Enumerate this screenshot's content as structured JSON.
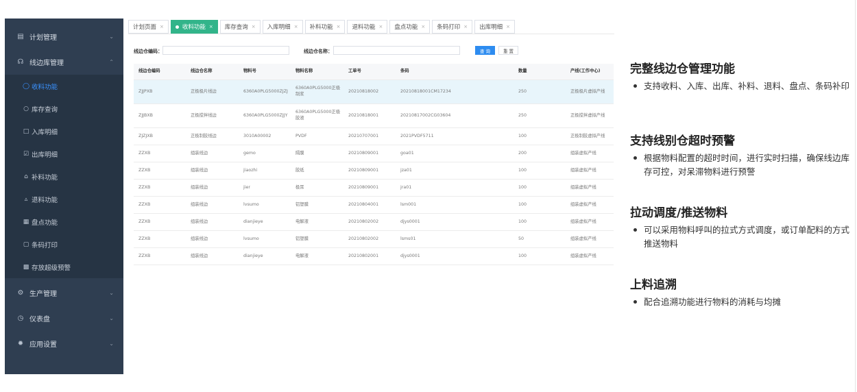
{
  "sidebar": {
    "menus": [
      {
        "label": "计划管理",
        "icon": "calendar-icon"
      },
      {
        "label": "线边库管理",
        "icon": "cart-icon"
      },
      {
        "label": "生产管理",
        "icon": "gear-icon"
      },
      {
        "label": "仪表盘",
        "icon": "gauge-icon"
      },
      {
        "label": "应用设置",
        "icon": "settings-icon"
      }
    ],
    "subitems": [
      {
        "label": "收料功能",
        "icon": "receive-icon"
      },
      {
        "label": "库存查询",
        "icon": "stock-icon"
      },
      {
        "label": "入库明细",
        "icon": "folder-icon"
      },
      {
        "label": "出库明细",
        "icon": "checkbox-icon"
      },
      {
        "label": "补料功能",
        "icon": "home-icon"
      },
      {
        "label": "退料功能",
        "icon": "return-icon"
      },
      {
        "label": "盘点功能",
        "icon": "inventory-icon"
      },
      {
        "label": "条码打印",
        "icon": "message-icon"
      },
      {
        "label": "存放超级预警",
        "icon": "chart-icon"
      }
    ],
    "active_subitem": "收料功能"
  },
  "tabs": [
    "计划页面",
    "收料功能",
    "库存查询",
    "入库明细",
    "补料功能",
    "退料功能",
    "盘点功能",
    "条码打印",
    "出库明细"
  ],
  "active_tab": "收料功能",
  "filters": {
    "code_label": "线边仓编码：",
    "name_label": "线边仓名称：",
    "query_button": "查 询",
    "reset_button": "重 置"
  },
  "table": {
    "columns": [
      "线边仓编码",
      "线边仓名称",
      "物料号",
      "物料名称",
      "工单号",
      "条码",
      "数量",
      "产线(工作中心)"
    ],
    "rows": [
      [
        "ZJJPXB",
        "正极极片线边",
        "6360A0PLG5000ZJZJ",
        "6360A0PLG5000正极制浆",
        "20210818002",
        "20210818001CM17234",
        "250",
        "正极极片虚拟产线"
      ],
      [
        "ZJJBXB",
        "正极搅拌线边",
        "6360A0PLG5000ZJJY",
        "6360A0PLG5000正极胶液",
        "20210818001",
        "20210817002CG03604",
        "250",
        "正极搅拌虚拟产线"
      ],
      [
        "ZJZJXB",
        "正极制胶线边",
        "3010A00002",
        "PVDF",
        "20210707001",
        "2021PVDF5711",
        "100",
        "正极制胶虚拟产线"
      ],
      [
        "ZZXB",
        "组装线边",
        "gemo",
        "隔膜",
        "20210809001",
        "goa01",
        "200",
        "组装虚拟产线"
      ],
      [
        "ZZXB",
        "组装线边",
        "jiaozhi",
        "胶纸",
        "20210809001",
        "jza01",
        "100",
        "组装虚拟产线"
      ],
      [
        "ZZXB",
        "组装线边",
        "jier",
        "极耳",
        "20210809001",
        "jra01",
        "100",
        "组装虚拟产线"
      ],
      [
        "ZZXB",
        "组装线边",
        "lvsumo",
        "铝塑膜",
        "20210804001",
        "lsm001",
        "100",
        "组装虚拟产线"
      ],
      [
        "ZZXB",
        "组装线边",
        "dianjieye",
        "电解液",
        "20210802002",
        "djys0001",
        "100",
        "组装虚拟产线"
      ],
      [
        "ZZXB",
        "组装线边",
        "lvsumo",
        "铝塑膜",
        "20210802002",
        "lsms01",
        "50",
        "组装虚拟产线"
      ],
      [
        "ZZXB",
        "组装线边",
        "dianjieye",
        "电解液",
        "20210802001",
        "djys0001",
        "100",
        "组装虚拟产线"
      ]
    ]
  },
  "features": [
    {
      "title": "完整线边仓管理功能",
      "text": "支持收料、入库、出库、补料、退料、盘点、条码补印"
    },
    {
      "title": "支持线别仓超时预警",
      "text": "根据物料配置的超时时间，进行实时扫描，确保线边库存可控，对呆滞物料进行预警"
    },
    {
      "title": "拉动调度/推送物料",
      "text": "可以采用物料呼叫的拉式方式调度，或订单配料的方式推送物料"
    },
    {
      "title": "上料追溯",
      "text": "配合追溯功能进行物料的消耗与均摊"
    }
  ],
  "colors": {
    "sidebar_bg": "#2f3e51",
    "submenu_bg": "#263444",
    "active_blue": "#3a92ff",
    "active_tab_green": "#32b48a",
    "primary_button": "#2d8cf0",
    "selected_row": "#e8f5fb"
  }
}
